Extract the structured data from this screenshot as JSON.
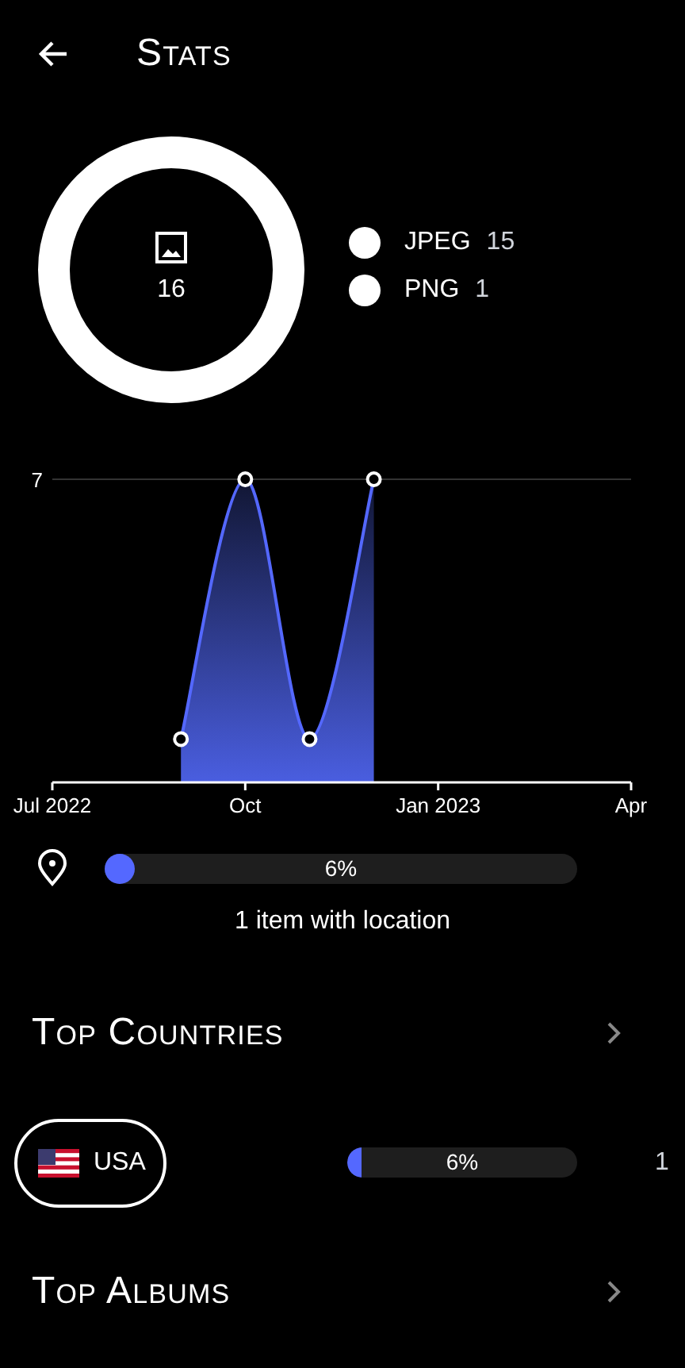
{
  "header": {
    "title": "Stats"
  },
  "file_types": {
    "total": "16",
    "legend": [
      {
        "label": "JPEG",
        "count": "15"
      },
      {
        "label": "PNG",
        "count": "1"
      }
    ]
  },
  "timeline": {
    "chart_data": {
      "type": "area",
      "categories": [
        "Jul 2022",
        null,
        null,
        "Oct",
        null,
        null,
        "Jan 2023",
        null,
        null,
        "Apr"
      ],
      "series": [
        {
          "color": "#5468ff",
          "values": [
            null,
            null,
            1,
            7,
            1,
            7,
            null,
            null,
            null,
            null
          ]
        }
      ],
      "ylim": [
        0,
        7
      ],
      "yticks": [
        7
      ]
    }
  },
  "location": {
    "level": 0.06,
    "percent": "6%",
    "caption": "1 item with location"
  },
  "sections": [
    {
      "title": "Top Countries",
      "items": [
        {
          "name": "USA",
          "level": 0.06,
          "percent": "6%",
          "count": "1"
        }
      ]
    },
    {
      "title": "Top Albums"
    }
  ]
}
